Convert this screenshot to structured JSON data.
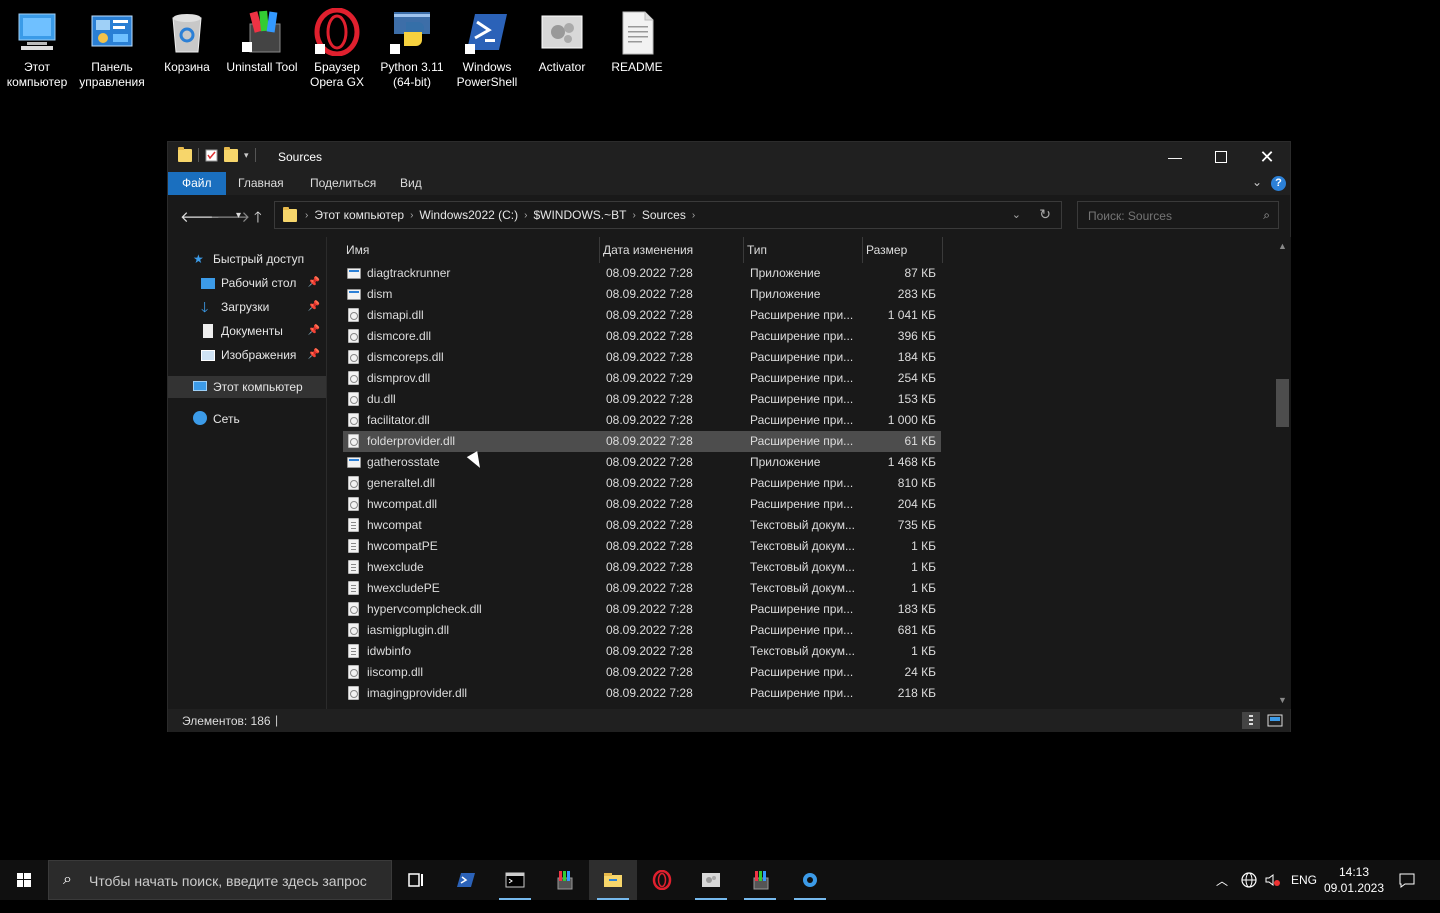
{
  "desktop": {
    "icons": [
      {
        "label": "Этот компьютер"
      },
      {
        "label": "Панель управления"
      },
      {
        "label": "Корзина"
      },
      {
        "label": "Uninstall Tool"
      },
      {
        "label": "Браузер Opera GX"
      },
      {
        "label": "Python 3.11 (64-bit)"
      },
      {
        "label": "Windows PowerShell"
      },
      {
        "label": "Activator"
      },
      {
        "label": "README"
      }
    ]
  },
  "window": {
    "title": "Sources",
    "ribbon_tabs": [
      "Файл",
      "Главная",
      "Поделиться",
      "Вид"
    ],
    "help_label": "?",
    "breadcrumbs": [
      "Этот компьютер",
      "Windows2022 (C:)",
      "$WINDOWS.~BT",
      "Sources"
    ],
    "search_placeholder": "Поиск: Sources",
    "nav": {
      "quick_access": "Быстрый доступ",
      "items": [
        {
          "label": "Рабочий стол"
        },
        {
          "label": "Загрузки"
        },
        {
          "label": "Документы"
        },
        {
          "label": "Изображения"
        }
      ],
      "this_pc": "Этот компьютер",
      "network": "Сеть"
    },
    "columns": {
      "name": "Имя",
      "date": "Дата изменения",
      "type": "Тип",
      "size": "Размер"
    },
    "files": [
      {
        "name": "diagtrackrunner",
        "date": "08.09.2022 7:28",
        "type": "Приложение",
        "size": "87 КБ",
        "kind": "app"
      },
      {
        "name": "dism",
        "date": "08.09.2022 7:28",
        "type": "Приложение",
        "size": "283 КБ",
        "kind": "app"
      },
      {
        "name": "dismapi.dll",
        "date": "08.09.2022 7:28",
        "type": "Расширение при...",
        "size": "1 041 КБ",
        "kind": "dll"
      },
      {
        "name": "dismcore.dll",
        "date": "08.09.2022 7:28",
        "type": "Расширение при...",
        "size": "396 КБ",
        "kind": "dll"
      },
      {
        "name": "dismcoreps.dll",
        "date": "08.09.2022 7:28",
        "type": "Расширение при...",
        "size": "184 КБ",
        "kind": "dll"
      },
      {
        "name": "dismprov.dll",
        "date": "08.09.2022 7:29",
        "type": "Расширение при...",
        "size": "254 КБ",
        "kind": "dll"
      },
      {
        "name": "du.dll",
        "date": "08.09.2022 7:28",
        "type": "Расширение при...",
        "size": "153 КБ",
        "kind": "dll"
      },
      {
        "name": "facilitator.dll",
        "date": "08.09.2022 7:28",
        "type": "Расширение при...",
        "size": "1 000 КБ",
        "kind": "dll"
      },
      {
        "name": "folderprovider.dll",
        "date": "08.09.2022 7:28",
        "type": "Расширение при...",
        "size": "61 КБ",
        "kind": "dll",
        "highlight": true
      },
      {
        "name": "gatherosstate",
        "date": "08.09.2022 7:28",
        "type": "Приложение",
        "size": "1 468 КБ",
        "kind": "app"
      },
      {
        "name": "generaltel.dll",
        "date": "08.09.2022 7:28",
        "type": "Расширение при...",
        "size": "810 КБ",
        "kind": "dll"
      },
      {
        "name": "hwcompat.dll",
        "date": "08.09.2022 7:28",
        "type": "Расширение при...",
        "size": "204 КБ",
        "kind": "dll"
      },
      {
        "name": "hwcompat",
        "date": "08.09.2022 7:28",
        "type": "Текстовый докум...",
        "size": "735 КБ",
        "kind": "txt"
      },
      {
        "name": "hwcompatPE",
        "date": "08.09.2022 7:28",
        "type": "Текстовый докум...",
        "size": "1 КБ",
        "kind": "txt"
      },
      {
        "name": "hwexclude",
        "date": "08.09.2022 7:28",
        "type": "Текстовый докум...",
        "size": "1 КБ",
        "kind": "txt"
      },
      {
        "name": "hwexcludePE",
        "date": "08.09.2022 7:28",
        "type": "Текстовый докум...",
        "size": "1 КБ",
        "kind": "txt"
      },
      {
        "name": "hypervcomplcheck.dll",
        "date": "08.09.2022 7:28",
        "type": "Расширение при...",
        "size": "183 КБ",
        "kind": "dll"
      },
      {
        "name": "iasmigplugin.dll",
        "date": "08.09.2022 7:28",
        "type": "Расширение при...",
        "size": "681 КБ",
        "kind": "dll"
      },
      {
        "name": "idwbinfo",
        "date": "08.09.2022 7:28",
        "type": "Текстовый докум...",
        "size": "1 КБ",
        "kind": "txt"
      },
      {
        "name": "iiscomp.dll",
        "date": "08.09.2022 7:28",
        "type": "Расширение при...",
        "size": "24 КБ",
        "kind": "dll"
      },
      {
        "name": "imagingprovider.dll",
        "date": "08.09.2022 7:28",
        "type": "Расширение при...",
        "size": "218 КБ",
        "kind": "dll"
      }
    ],
    "status": "Элементов: 186"
  },
  "taskbar": {
    "search_placeholder": "Чтобы начать поиск, введите здесь запрос",
    "lang": "ENG",
    "time": "14:13",
    "date": "09.01.2023"
  },
  "colors": {
    "accent": "#1a6fbf",
    "highlight": "#4d4d4d",
    "taskbar_underline": "#76b9ed"
  }
}
